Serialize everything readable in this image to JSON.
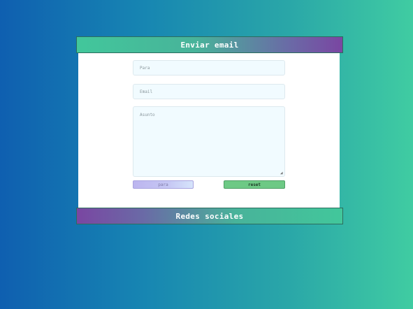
{
  "header": {
    "title": "Enviar email"
  },
  "form": {
    "para_placeholder": "Para",
    "email_placeholder": "Email",
    "asunto_placeholder": "Asunto",
    "send_label": "para",
    "reset_label": "reset"
  },
  "footer": {
    "title": "Redes sociales"
  },
  "icons": {
    "resize": "resize-grip-icon"
  }
}
